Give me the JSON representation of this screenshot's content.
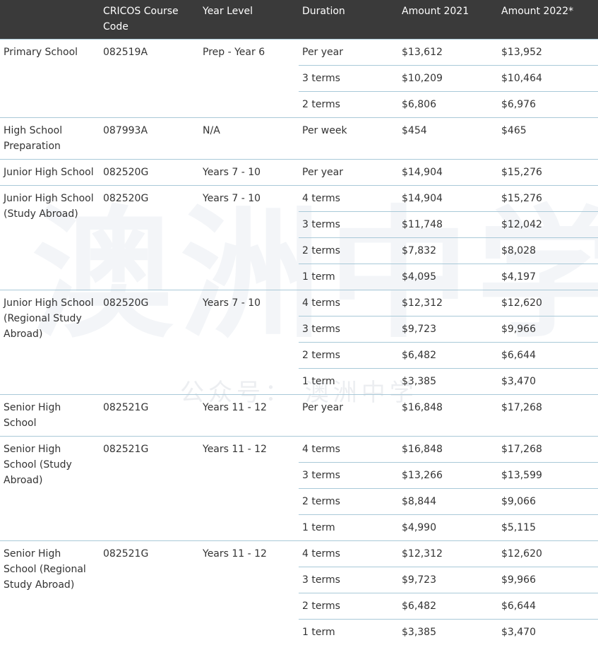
{
  "headers": [
    "",
    "CRICOS Course Code",
    "Year Level",
    "Duration",
    "Amount 2021",
    "Amount 2022*"
  ],
  "groups": [
    {
      "name": "Primary School",
      "code": "082519A",
      "level": "Prep - Year 6",
      "rows": [
        [
          "Per year",
          "$13,612",
          "$13,952"
        ],
        [
          "3 terms",
          "$10,209",
          "$10,464"
        ],
        [
          "2 terms",
          "$6,806",
          "$6,976"
        ]
      ]
    },
    {
      "name": "High School Preparation",
      "code": "087993A",
      "level": "N/A",
      "rows": [
        [
          "Per week",
          "$454",
          "$465"
        ]
      ]
    },
    {
      "name": "Junior High School",
      "code": "082520G",
      "level": "Years 7 - 10",
      "rows": [
        [
          "Per year",
          "$14,904",
          "$15,276"
        ]
      ]
    },
    {
      "name": "Junior High School (Study Abroad)",
      "code": "082520G",
      "level": "Years 7 - 10",
      "rows": [
        [
          "4 terms",
          "$14,904",
          "$15,276"
        ],
        [
          "3 terms",
          "$11,748",
          "$12,042"
        ],
        [
          "2 terms",
          "$7,832",
          "$8,028"
        ],
        [
          "1 term",
          "$4,095",
          "$4,197"
        ]
      ]
    },
    {
      "name": "Junior High School (Regional Study Abroad)",
      "code": "082520G",
      "level": "Years 7 - 10",
      "rows": [
        [
          "4 terms",
          "$12,312",
          "$12,620"
        ],
        [
          "3 terms",
          "$9,723",
          "$9,966"
        ],
        [
          "2 terms",
          "$6,482",
          "$6,644"
        ],
        [
          "1 term",
          "$3,385",
          "$3,470"
        ]
      ]
    },
    {
      "name": "Senior High School",
      "code": "082521G",
      "level": "Years 11 - 12",
      "rows": [
        [
          "Per year",
          "$16,848",
          "$17,268"
        ]
      ]
    },
    {
      "name": "Senior High School (Study Abroad)",
      "code": "082521G",
      "level": "Years 11 - 12",
      "rows": [
        [
          "4 terms",
          "$16,848",
          "$17,268"
        ],
        [
          "3 terms",
          "$13,266",
          "$13,599"
        ],
        [
          "2 terms",
          "$8,844",
          "$9,066"
        ],
        [
          "1 term",
          "$4,990",
          "$5,115"
        ]
      ]
    },
    {
      "name": "Senior High School (Regional Study Abroad)",
      "code": "082521G",
      "level": "Years 11 - 12",
      "rows": [
        [
          "4 terms",
          "$12,312",
          "$12,620"
        ],
        [
          "3 terms",
          "$9,723",
          "$9,966"
        ],
        [
          "2 terms",
          "$6,482",
          "$6,644"
        ],
        [
          "1 term",
          "$3,385",
          "$3,470"
        ]
      ]
    }
  ],
  "watermark": {
    "main": "澳洲中学",
    "sub": "公众号： 澳洲中学"
  }
}
